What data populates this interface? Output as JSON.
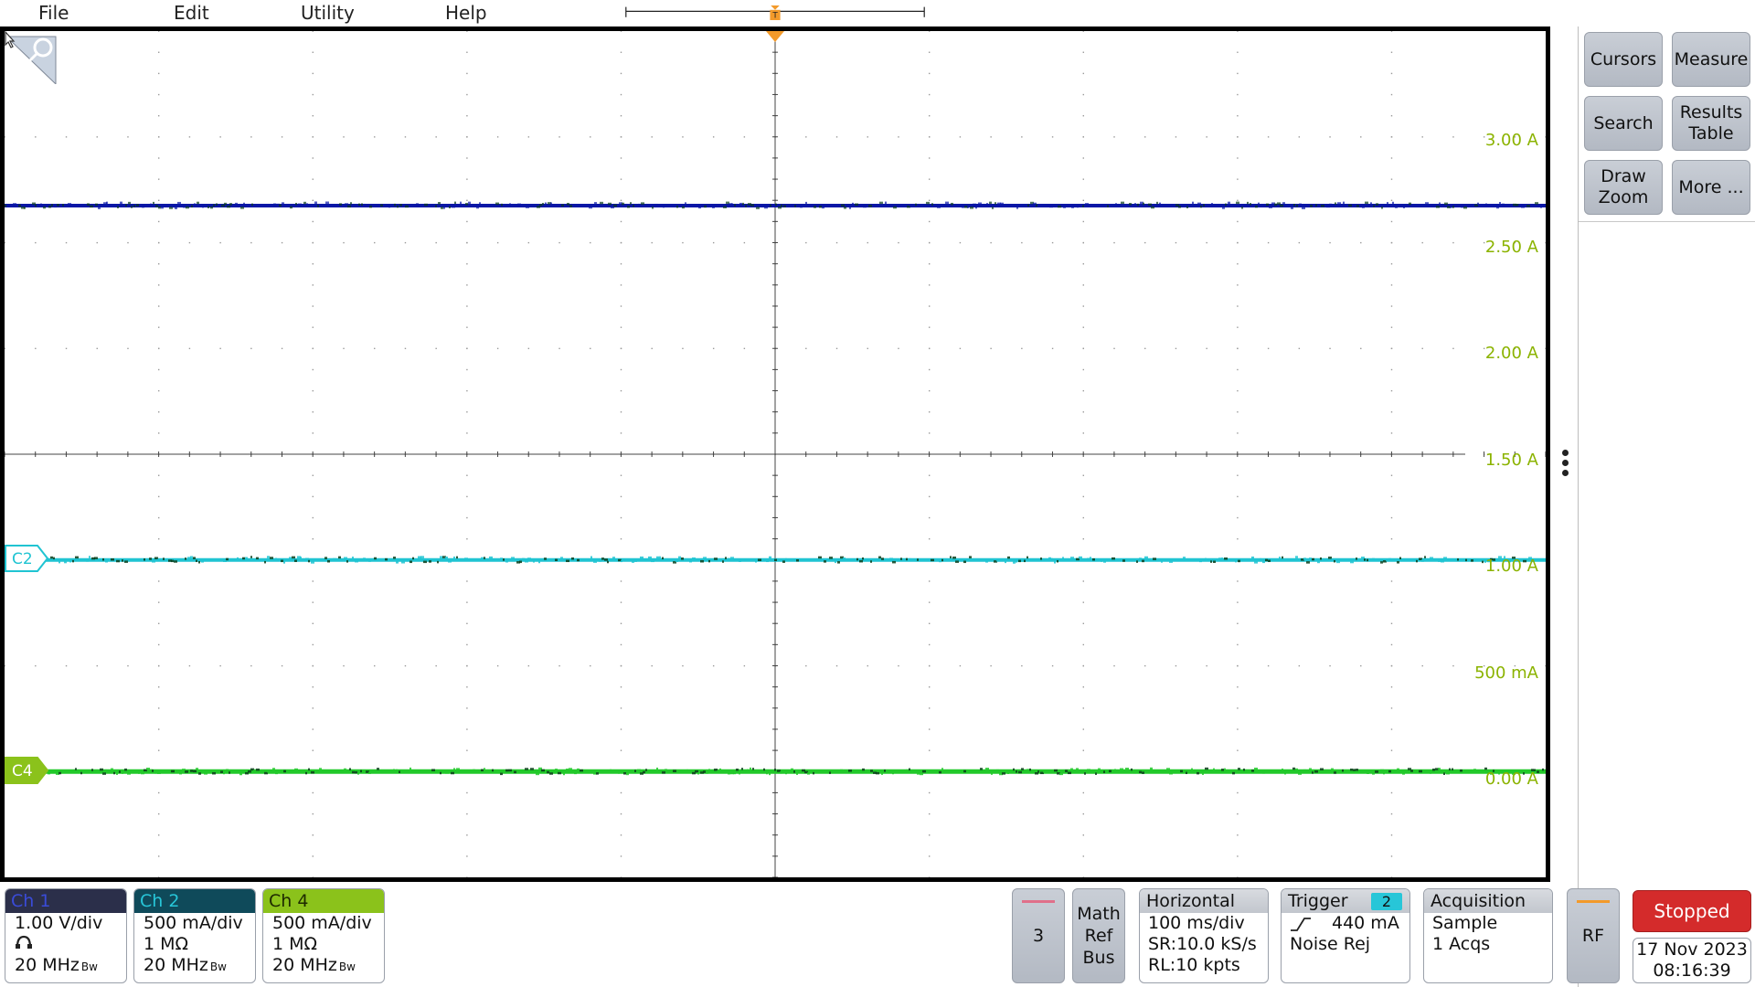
{
  "menu": {
    "file": "File",
    "edit": "Edit",
    "utility": "Utility",
    "help": "Help"
  },
  "trigger_marker": "T",
  "scale_labels": [
    "3.00 A",
    "2.50 A",
    "2.00 A",
    "1.50 A",
    "1.00 A",
    "500 mA",
    "0.00 A"
  ],
  "channel_markers": {
    "c2": "C2",
    "c4": "C4"
  },
  "colors": {
    "ch1": "#0a17a6",
    "ch2": "#20c4d2",
    "ch4": "#22c92a",
    "scale": "#8bb300",
    "stopped": "#d42b2b"
  },
  "side_buttons": {
    "cursors": "Cursors",
    "measure": "Measure",
    "search": "Search",
    "results_table": "Results\nTable",
    "draw_zoom": "Draw\nZoom",
    "more": "More ..."
  },
  "channels": [
    {
      "title": "Ch 1",
      "scale": "1.00 V/div",
      "bandwidth": "20 MHz",
      "bw_icon": "probe-icon"
    },
    {
      "title": "Ch 2",
      "scale": "500 mA/div",
      "impedance": "1 MΩ",
      "bandwidth": "20 MHz"
    },
    {
      "title": "Ch 4",
      "scale": "500 mA/div",
      "impedance": "1 MΩ",
      "bandwidth": "20 MHz"
    }
  ],
  "bw_suffix": "Bw",
  "channel3_button": "3",
  "math_ref_bus": "Math\nRef\nBus",
  "horizontal": {
    "title": "Horizontal",
    "scale": "100 ms/div",
    "sr": "SR:10.0 kS/s",
    "rl": "RL:10 kpts"
  },
  "trigger": {
    "title": "Trigger",
    "source": "2",
    "level": "440 mA",
    "mode": "Noise Rej"
  },
  "acquisition": {
    "title": "Acquisition",
    "mode": "Sample",
    "count": "1 Acqs"
  },
  "rf_button": "RF",
  "status": {
    "run_state": "Stopped",
    "date": "17 Nov 2023",
    "time": "08:16:39"
  }
}
